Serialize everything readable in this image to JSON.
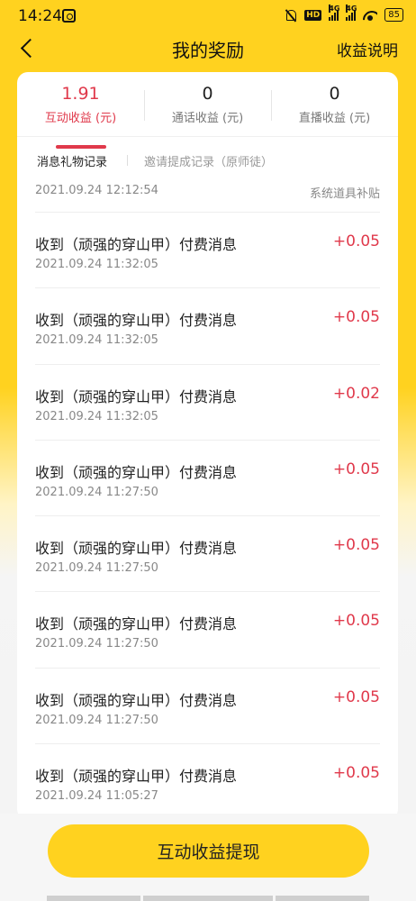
{
  "status_bar": {
    "time": "14:24",
    "hd": "HD",
    "signal1_label": "4G",
    "signal2_label": "4G",
    "battery": "85"
  },
  "nav": {
    "title": "我的奖励",
    "action": "收益说明"
  },
  "stats": [
    {
      "value": "1.91",
      "label": "互动收益 (元)",
      "active": true
    },
    {
      "value": "0",
      "label": "通话收益 (元)",
      "active": false
    },
    {
      "value": "0",
      "label": "直播收益 (元)",
      "active": false
    }
  ],
  "subtabs": [
    {
      "label": "消息礼物记录",
      "active": true
    },
    {
      "label": "邀请提成记录（原师徒）",
      "active": false
    }
  ],
  "partial_record": {
    "time": "2021.09.24 12:12:54",
    "source": "系统道具补贴"
  },
  "records": [
    {
      "title": "收到（顽强的穿山甲）付费消息",
      "time": "2021.09.24 11:32:05",
      "amount": "+0.05"
    },
    {
      "title": "收到（顽强的穿山甲）付费消息",
      "time": "2021.09.24 11:32:05",
      "amount": "+0.05"
    },
    {
      "title": "收到（顽强的穿山甲）付费消息",
      "time": "2021.09.24 11:32:05",
      "amount": "+0.02"
    },
    {
      "title": "收到（顽强的穿山甲）付费消息",
      "time": "2021.09.24 11:27:50",
      "amount": "+0.05"
    },
    {
      "title": "收到（顽强的穿山甲）付费消息",
      "time": "2021.09.24 11:27:50",
      "amount": "+0.05"
    },
    {
      "title": "收到（顽强的穿山甲）付费消息",
      "time": "2021.09.24 11:27:50",
      "amount": "+0.05"
    },
    {
      "title": "收到（顽强的穿山甲）付费消息",
      "time": "2021.09.24 11:27:50",
      "amount": "+0.05"
    },
    {
      "title": "收到（顽强的穿山甲）付费消息",
      "time": "2021.09.24 11:05:27",
      "amount": "+0.05"
    }
  ],
  "withdraw_button": "互动收益提现",
  "colors": {
    "accent_yellow": "#ffd21f",
    "amount_red": "#e0394b"
  }
}
